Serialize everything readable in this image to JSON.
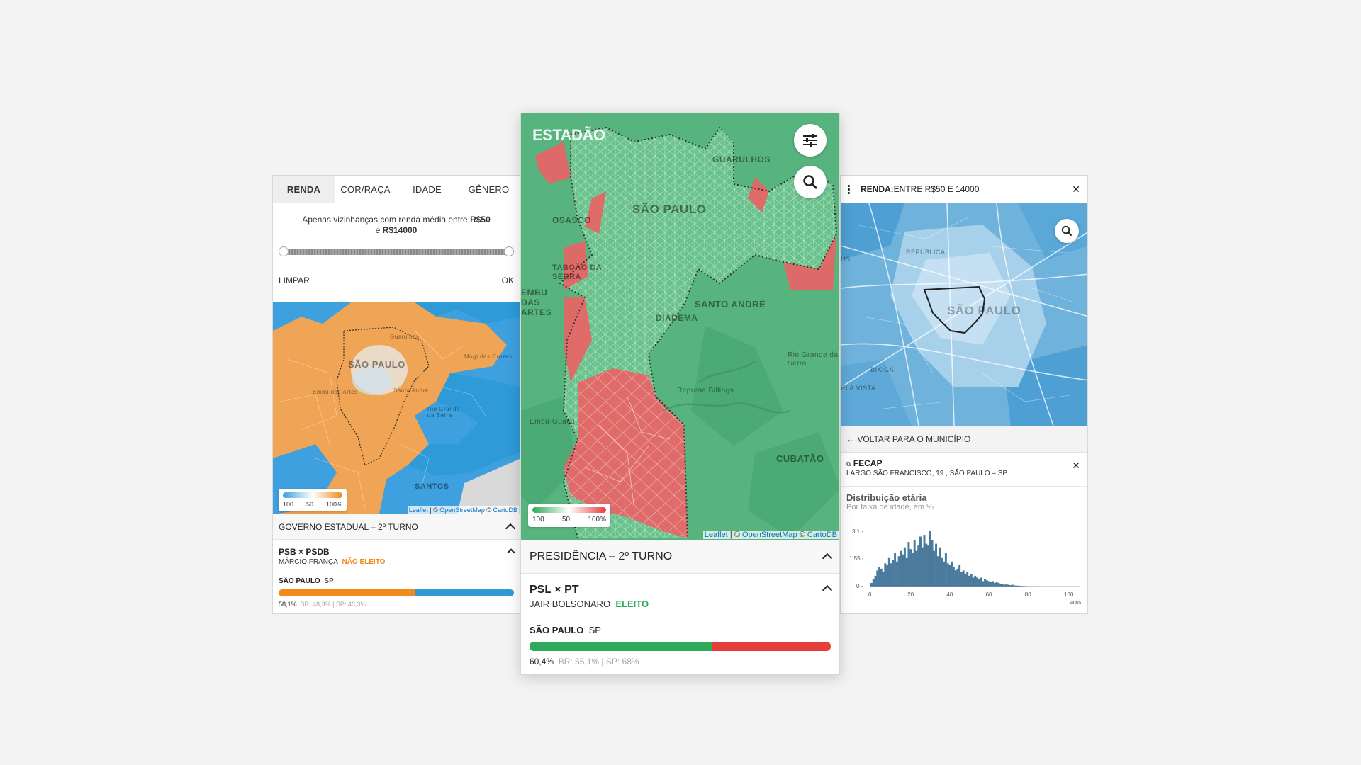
{
  "left": {
    "tabs": [
      "RENDA",
      "COR/RAÇA",
      "IDADE",
      "GÊNERO"
    ],
    "filter_note_prefix": "Apenas vizinhanças com renda média entre ",
    "filter_note_min": "R$50",
    "filter_note_mid": "e ",
    "filter_note_max": "R$14000",
    "clear_label": "LIMPAR",
    "ok_label": "OK",
    "map_labels": {
      "city": "SÃO PAULO",
      "santos": "SANTOS",
      "guarulhos": "Guarulhos",
      "mogi": "Mogi das Cruzes",
      "embu": "Embu das Artes",
      "santo_andre": "Santo André",
      "rio_grande": "Rio Grande da Serra"
    },
    "legend": {
      "ticks": [
        "100",
        "50",
        "100%"
      ]
    },
    "attribution": {
      "leaflet": "Leaflet",
      "sep": " | © ",
      "osm": "OpenStreetMap",
      "sep2": " © ",
      "carto": "CartoDB"
    },
    "section_title": "GOVERNO ESTADUAL – 2º TURNO",
    "race": "PSB × PSDB",
    "candidate": "MÁRCIO FRANÇA",
    "status": "NÃO ELEITO",
    "region": "SÃO PAULO",
    "region_code": "SP",
    "share": "58,1%",
    "share_detail": "BR: 48,3% | SP: 48,3%",
    "bar_fraction": 0.581,
    "colors": {
      "a": "#f18a1a",
      "b": "#2e9ad8"
    }
  },
  "center": {
    "logo": "ESTADÃO",
    "map_labels": {
      "city": "SÃO PAULO",
      "guarulhos": "GUARULHOS",
      "osasco": "OSASCO",
      "taboao": "TABOÃO DA SERRA",
      "embu": "EMBU DAS ARTES",
      "santo_andre": "SANTO ANDRÉ",
      "diadema": "DIADEMA",
      "rio_grande": "Rio Grande da Serra",
      "billings": "Represa Billings",
      "embu_guacu": "Embu-Guaçu",
      "cubatao": "CUBATÃO"
    },
    "legend": {
      "ticks": [
        "100",
        "50",
        "100%"
      ]
    },
    "attribution": {
      "leaflet": "Leaflet",
      "sep": " | © ",
      "osm": "OpenStreetMap",
      "sep2": " © ",
      "carto": "CartoDB"
    },
    "section_title": "PRESIDÊNCIA – 2º TURNO",
    "race": "PSL × PT",
    "candidate": "JAIR BOLSONARO",
    "status": "ELEITO",
    "region": "SÃO PAULO",
    "region_code": "SP",
    "share": "60,4%",
    "share_detail": "BR: 55,1% | SP: 68%",
    "bar_fraction": 0.604,
    "colors": {
      "a": "#2eaa5a",
      "b": "#e63e3a"
    },
    "icons": [
      "sliders-icon",
      "search-icon"
    ]
  },
  "right": {
    "header_bold": "RENDA:",
    "header_rest": " ENTRE R$50 E 14000",
    "map_labels": {
      "city": "SÃO PAULO",
      "republica": "REPÚBLICA",
      "bixiga": "BIXIGA",
      "bela_vista": "BELA VISTA",
      "us": "US"
    },
    "back_label": "← VOLTAR PARA O MUNICÍPIO",
    "place_name": "FECAP",
    "place_address": "LARGO SÃO FRANCISCO, 19 , SÃO PAULO – SP",
    "hist_title": "Distribuição etária",
    "hist_subtitle": "Por faixa de idade, em %",
    "hist_yticks": [
      "3,1 -",
      "1,55 -",
      "0 -"
    ],
    "hist_xticks": [
      "0",
      "20",
      "40",
      "60",
      "80",
      "100"
    ],
    "hist_xunit": "anos"
  },
  "chart_data": {
    "type": "bar",
    "title": "Distribuição etária",
    "subtitle": "Por faixa de idade, em %",
    "xlabel": "anos",
    "ylabel": "",
    "ylim": [
      0,
      3.1
    ],
    "xlim": [
      0,
      100
    ],
    "x": [
      0,
      1,
      2,
      3,
      4,
      5,
      6,
      7,
      8,
      9,
      10,
      11,
      12,
      13,
      14,
      15,
      16,
      17,
      18,
      19,
      20,
      21,
      22,
      23,
      24,
      25,
      26,
      27,
      28,
      29,
      30,
      31,
      32,
      33,
      34,
      35,
      36,
      37,
      38,
      39,
      40,
      41,
      42,
      43,
      44,
      45,
      46,
      47,
      48,
      49,
      50,
      51,
      52,
      53,
      54,
      55,
      56,
      57,
      58,
      59,
      60,
      61,
      62,
      63,
      64,
      65,
      66,
      67,
      68,
      69,
      70,
      71,
      72,
      73,
      74,
      75,
      76,
      77,
      78,
      79,
      80,
      81,
      82,
      83,
      84,
      85,
      86,
      87,
      88,
      89
    ],
    "values": [
      0.2,
      0.4,
      0.6,
      0.9,
      1.1,
      1.0,
      0.8,
      1.3,
      1.2,
      1.6,
      1.3,
      1.5,
      1.9,
      1.4,
      1.7,
      2.0,
      1.8,
      2.2,
      1.6,
      2.5,
      2.1,
      1.9,
      2.6,
      2.0,
      2.3,
      2.8,
      2.2,
      2.9,
      2.4,
      2.3,
      3.1,
      2.6,
      2.0,
      2.4,
      1.7,
      2.2,
      1.6,
      1.4,
      1.9,
      1.3,
      1.2,
      1.4,
      1.1,
      0.9,
      1.0,
      1.2,
      0.8,
      0.9,
      0.7,
      0.8,
      0.6,
      0.7,
      0.5,
      0.6,
      0.5,
      0.4,
      0.5,
      0.3,
      0.4,
      0.35,
      0.3,
      0.25,
      0.3,
      0.2,
      0.25,
      0.2,
      0.15,
      0.15,
      0.1,
      0.15,
      0.1,
      0.08,
      0.1,
      0.06,
      0.05,
      0.05,
      0.04,
      0.03,
      0.03,
      0.02,
      0.02,
      0.02,
      0.01,
      0.01,
      0.01,
      0.01,
      0.01,
      0.0,
      0.0,
      0.0
    ],
    "color": "#4a7a9c"
  }
}
